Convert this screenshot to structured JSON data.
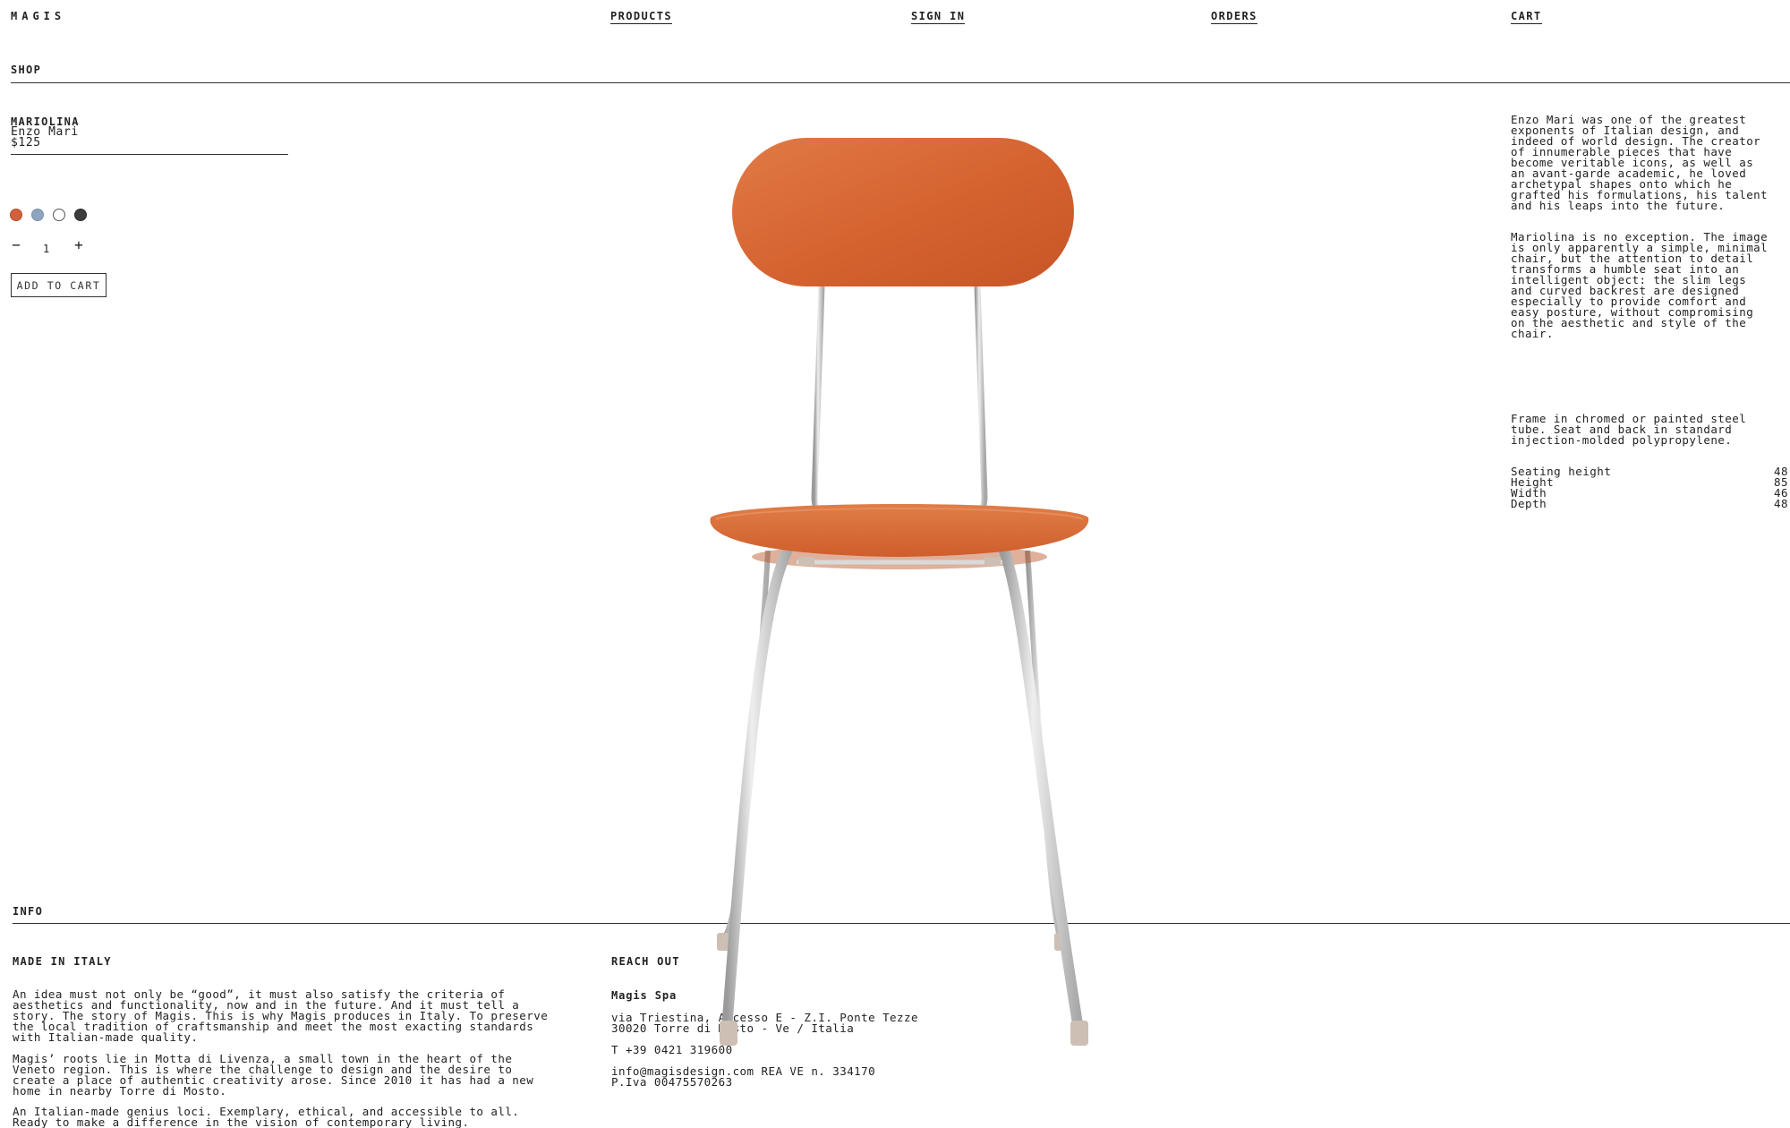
{
  "header": {
    "logo": "MAGIS",
    "nav": [
      "PRODUCTS",
      "SIGN IN",
      "ORDERS",
      "CART"
    ],
    "section": "SHOP"
  },
  "product": {
    "name": "MARIOLINA",
    "designer": "Enzo Mari",
    "price": "$125",
    "swatches": [
      "#d2603a",
      "#8ea5bd",
      "#ffffff",
      "#3d3d3d"
    ],
    "qty_minus": "−",
    "quantity": "1",
    "qty_plus": "+",
    "add_to_cart": "ADD TO CART",
    "image_alt": "Mariolina chair in orange",
    "colors": {
      "seat": "#d4622f",
      "frame": "#c9c9c9",
      "feet": "#cdbfb3"
    }
  },
  "description": {
    "designer_bio": "Enzo Mari was one of the greatest\nexponents of Italian design, and\nindeed of world design. The creator\nof innumerable pieces that have\nbecome veritable icons, as well as\nan avant-garde academic, he loved\narchetypal shapes onto which he\ngrafted his formulations, his talent\nand his leaps into the future.",
    "product_text": "Mariolina is no exception. The image\nis only apparently a simple, minimal\nchair, but the attention to detail\ntransforms a humble seat into an\nintelligent object: the slim legs\nand curved backrest are designed\nespecially to provide comfort and\neasy posture, without compromising\non the aesthetic and style of the\nchair.",
    "materials": "Frame in chromed or painted steel\ntube. Seat and back in standard\ninjection-molded polypropylene."
  },
  "specs": [
    {
      "label": "Seating height",
      "value": "48"
    },
    {
      "label": "Height",
      "value": "85"
    },
    {
      "label": "Width",
      "value": "46"
    },
    {
      "label": "Depth",
      "value": "48"
    }
  ],
  "footer": {
    "section": "INFO",
    "made_heading": "MADE IN ITALY",
    "made_p1": "An idea must not only be “good”, it must also satisfy the criteria of\naesthetics and functionality, now and in the future. And it must tell a\nstory. The story of Magis. This is why Magis produces in Italy. To preserve\nthe local tradition of craftsmanship and meet the most exacting standards\nwith Italian-made quality.",
    "made_p2": "Magis’ roots lie in Motta di Livenza, a small town in the heart of the\nVeneto region. This is where the challenge to design and the desire to\ncreate a place of authentic creativity arose. Since 2010 it has had a new\nhome in nearby Torre di Mosto.",
    "made_p3": "An Italian-made genius loci. Exemplary, ethical, and accessible to all.\nReady to make a difference in the vision of contemporary living.",
    "reach_heading": "REACH OUT",
    "company": "Magis Spa",
    "address": "via Triestina, Accesso E - Z.I. Ponte Tezze\n30020 Torre di Mosto - Ve / Italia",
    "phone": "T +39 0421 319600",
    "legal": "info@magisdesign.com REA VE n. 334170\nP.Iva 00475570263"
  }
}
